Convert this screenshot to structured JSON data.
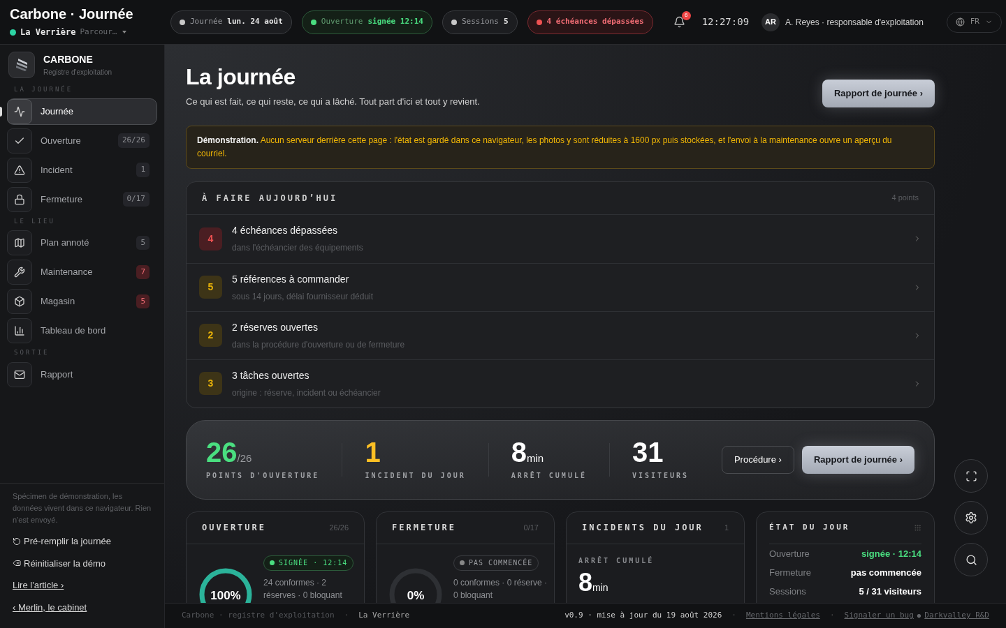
{
  "app": {
    "title": "Carbone · Journée",
    "site": "La Verrière",
    "site_hint": "Parcour…"
  },
  "status_pills": [
    {
      "label": "Journée",
      "value": "lun. 24 août",
      "color": "#c8c8c8"
    },
    {
      "label": "Ouverture",
      "value": "signée 12:14",
      "color": "#4ade80"
    },
    {
      "label": "Sessions",
      "value": "5",
      "color": "#c8c8c8"
    },
    {
      "value": "4 échéances dépassées",
      "color": "#f05252"
    }
  ],
  "notifications": "6",
  "clock": "12:27:09",
  "user": {
    "initials": "AR",
    "name": "A. Reyes · responsable d'exploitation"
  },
  "language": "FR",
  "sidebar": {
    "brand": "CARBONE",
    "brand_sub": "Registre d'exploitation",
    "sections": [
      {
        "title": "LA JOURNÉE",
        "items": [
          {
            "label": "Journée",
            "selected": true
          },
          {
            "label": "Ouverture",
            "badge": "26/26",
            "alert": false,
            "selected": false
          },
          {
            "label": "Incident",
            "badge": "1",
            "alert": false,
            "selected": false
          },
          {
            "label": "Fermeture",
            "badge": "0/17",
            "alert": false,
            "selected": false
          }
        ]
      },
      {
        "title": "LE LIEU",
        "items": [
          {
            "label": "Plan annoté",
            "badge": "5",
            "alert": false,
            "selected": false
          },
          {
            "label": "Maintenance",
            "badge": "7",
            "alert": true,
            "selected": false
          },
          {
            "label": "Magasin",
            "badge": "5",
            "alert": true,
            "selected": false
          },
          {
            "label": "Tableau de bord",
            "selected": false
          }
        ]
      },
      {
        "title": "SORTIE",
        "items": [
          {
            "label": "Rapport",
            "selected": false
          }
        ]
      }
    ],
    "note": "Spécimen de démonstration, les données vivent dans ce navigateur. Rien n'est envoyé.",
    "actions": [
      "Pré-remplir la journée",
      "Réinitialiser la démo"
    ],
    "links": [
      "Lire l'article ›",
      "‹ Merlin, le cabinet"
    ]
  },
  "page": {
    "title": "La journée",
    "subtitle": "Ce qui est fait, ce qui reste, ce qui a lâché. Tout part d'ici et tout y revient.",
    "report_button": "Rapport de journée ›"
  },
  "banner": {
    "label": "Démonstration.",
    "text": "Aucun serveur derrière cette page : l'état est gardé dans ce navigateur, les photos y sont réduites à 1600 px puis stockées, et l'envoi à la maintenance ouvre un aperçu du courriel."
  },
  "todo": {
    "title": "À FAIRE AUJOURD’HUI",
    "count": "4 points",
    "items": [
      {
        "number": "4",
        "title": "4 échéances dépassées",
        "detail": "dans l'échéancier des équipements",
        "urgent": true
      },
      {
        "number": "5",
        "title": "5 références à commander",
        "detail": "sous 14 jours, délai fournisseur déduit",
        "urgent": false
      },
      {
        "number": "2",
        "title": "2 réserves ouvertes",
        "detail": "dans la procédure d'ouverture ou de fermeture",
        "urgent": false
      },
      {
        "number": "3",
        "title": "3 tâches ouvertes",
        "detail": "origine : réserve, incident ou échéancier",
        "urgent": false
      }
    ]
  },
  "stats": {
    "items": [
      {
        "value": "26",
        "unit": "/26",
        "label": "POINTS D'OUVERTURE",
        "color": "#4ade80"
      },
      {
        "value": "1",
        "label": "INCIDENT DU JOUR",
        "color": "#fbbf24"
      },
      {
        "value": "8",
        "unit": "min",
        "label": "ARRÊT CUMULÉ",
        "color": "#ffffff"
      },
      {
        "value": "31",
        "label": "VISITEURS",
        "color": "#ffffff"
      }
    ],
    "buttons": [
      "Procédure ›",
      "Rapport de journée ›"
    ]
  },
  "cards": [
    {
      "kind": "procedure",
      "title": "OUVERTURE",
      "count": "26/26",
      "status": "SIGNÉE · 12:14",
      "signed": true,
      "percent": "100%",
      "detail": "24 conformes · 2 réserves · 0 bloquant"
    },
    {
      "kind": "procedure",
      "title": "FERMETURE",
      "count": "0/17",
      "status": "PAS COMMENCÉE",
      "signed": false,
      "percent": "0%",
      "detail": "0 conformes · 0 réserve · 0 bloquant"
    },
    {
      "kind": "incidents",
      "title": "INCIDENTS DU JOUR",
      "count": "1",
      "sublabel": "ARRÊT CUMULÉ",
      "value": "8",
      "unit": "min"
    },
    {
      "kind": "state",
      "title": "ÉTAT DU JOUR",
      "rows": [
        {
          "label": "Ouverture",
          "value": "signée · 12:14",
          "color": "#4ade80"
        },
        {
          "label": "Fermeture",
          "value": "pas commencée",
          "color": "#ffffff"
        },
        {
          "label": "Sessions",
          "value": "5 / 31 visiteurs",
          "color": "#ffffff"
        }
      ]
    }
  ],
  "footer": {
    "left": [
      {
        "kind": "text",
        "text": "Carbone · registre d'exploitation"
      },
      {
        "kind": "separator",
        "text": "·"
      },
      {
        "kind": "site",
        "text": "La Verrière"
      }
    ],
    "right": [
      {
        "kind": "version",
        "text": "v0.9 · mise à jour du 19 août 2026"
      },
      {
        "kind": "separator",
        "text": "·"
      },
      {
        "kind": "link",
        "text": "Mentions légales"
      },
      {
        "kind": "separator",
        "text": "·"
      },
      {
        "kind": "link",
        "text": "Signaler un bug"
      },
      {
        "kind": "bullet",
        "text": "●"
      },
      {
        "kind": "link",
        "text": "Darkvalley R&D"
      }
    ]
  }
}
